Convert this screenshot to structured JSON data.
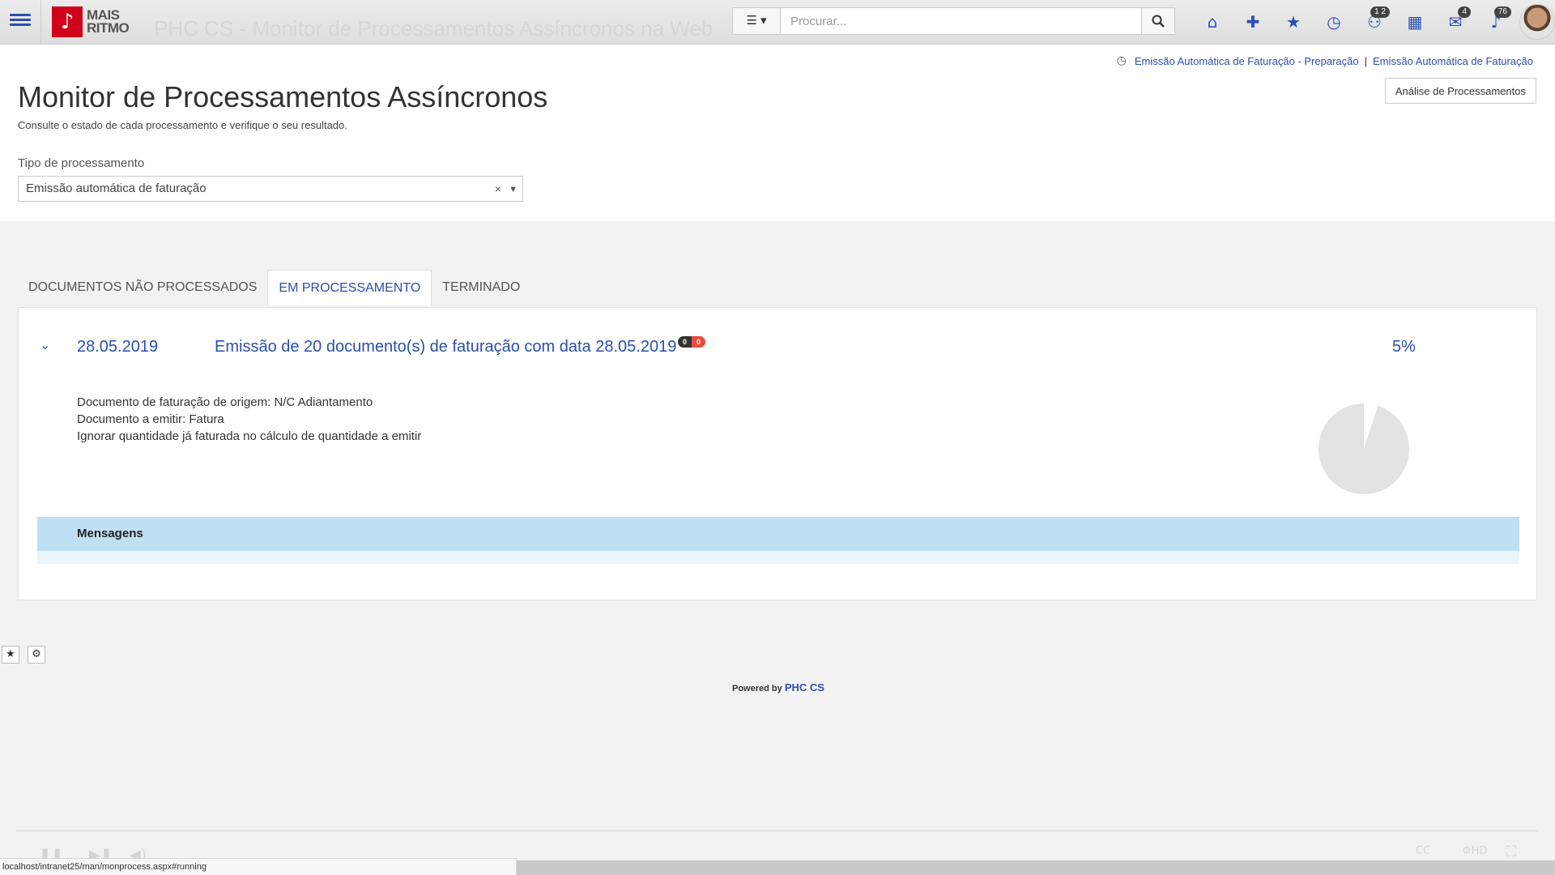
{
  "app": {
    "logo_glyph": "♪",
    "logo_line1": "MAIS",
    "logo_line2": "RITMO",
    "ghost_title": "PHC CS - Monitor de Processamentos Assíncronos na Web"
  },
  "toolbar": {
    "view_button_label": "☰ ▾",
    "search_placeholder": "Procurar...",
    "icons": [
      {
        "name": "home-icon",
        "glyph": "⌂",
        "badge": ""
      },
      {
        "name": "plus-icon",
        "glyph": "✚",
        "badge": ""
      },
      {
        "name": "star-icon",
        "glyph": "★",
        "badge": ""
      },
      {
        "name": "clock-icon",
        "glyph": "◷",
        "badge": ""
      },
      {
        "name": "users-icon",
        "glyph": "⚇",
        "badge": "1 2"
      },
      {
        "name": "calendar-icon",
        "glyph": "▦",
        "badge": ""
      },
      {
        "name": "mail-icon",
        "glyph": "✉",
        "badge": "4"
      },
      {
        "name": "bell-icon",
        "glyph": "♪",
        "badge": "76"
      }
    ]
  },
  "breadcrumb": {
    "item1": "Emissão Automática de Faturação - Preparação",
    "separator": "|",
    "item2": "Emissão Automática de Faturação"
  },
  "header": {
    "analysis_button": "Análise de Processamentos",
    "title": "Monitor de Processamentos Assíncronos",
    "subtitle": "Consulte o estado de cada processamento e verifique o seu resultado."
  },
  "filter": {
    "label": "Tipo de processamento",
    "value": "Emissão automática de faturação",
    "clear": "×",
    "caret": "▼"
  },
  "tabs": [
    {
      "label": "DOCUMENTOS NÃO PROCESSADOS",
      "active": false
    },
    {
      "label": "EM PROCESSAMENTO",
      "active": true
    },
    {
      "label": "TERMINADO",
      "active": false
    }
  ],
  "process": {
    "date": "28.05.2019",
    "description": "Emissão de 20 documento(s) de faturação com data 28.05.2019",
    "count_dark": "0",
    "count_red": "0",
    "percent_label": "5%",
    "progress_fraction": 0.05,
    "details": [
      "Documento de faturação de origem: N/C Adiantamento",
      "Documento a emitir: Fatura",
      "Ignorar quantidade já faturada no cálculo de quantidade a emitir"
    ],
    "messages_header": "Mensagens"
  },
  "footer": {
    "powered_prefix": "Powered by",
    "powered_brand": "PHC CS"
  },
  "statusbar": {
    "url": "localhost/intranet25/man/monprocess.aspx#running"
  },
  "colors": {
    "accent": "#2b4fb0",
    "brand_red": "#d0021b",
    "messages_bg": "#bfdff2"
  }
}
